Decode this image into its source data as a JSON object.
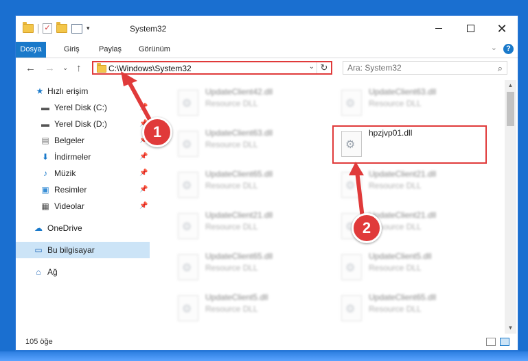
{
  "window": {
    "title": "System32",
    "controls": {
      "minimize": "minimize",
      "maximize": "maximize",
      "close": "✕"
    }
  },
  "ribbon": {
    "tabs": [
      "Dosya",
      "Giriş",
      "Paylaş",
      "Görünüm"
    ]
  },
  "address": {
    "path": "C:\\Windows\\System32",
    "search_placeholder": "Ara: System32"
  },
  "navigation": {
    "items": [
      {
        "label": "Hızlı erişim",
        "icon": "star-icon",
        "pinned": false
      },
      {
        "label": "Yerel Disk (C:)",
        "icon": "drive-icon",
        "pinned": true
      },
      {
        "label": "Yerel Disk (D:)",
        "icon": "drive-icon",
        "pinned": true
      },
      {
        "label": "Belgeler",
        "icon": "documents-icon",
        "pinned": true
      },
      {
        "label": "İndirmeler",
        "icon": "downloads-icon",
        "pinned": true
      },
      {
        "label": "Müzik",
        "icon": "music-icon",
        "pinned": true
      },
      {
        "label": "Resimler",
        "icon": "pictures-icon",
        "pinned": true
      },
      {
        "label": "Videolar",
        "icon": "videos-icon",
        "pinned": true
      },
      {
        "label": "OneDrive",
        "icon": "cloud-icon",
        "pinned": false
      },
      {
        "label": "Bu bilgisayar",
        "icon": "computer-icon",
        "pinned": false,
        "selected": true
      },
      {
        "label": "Ağ",
        "icon": "network-icon",
        "pinned": false
      }
    ]
  },
  "files": {
    "left_column": [
      {
        "name": "UpdateClient42.dll",
        "type": "Resource DLL"
      },
      {
        "name": "UpdateClient63.dll",
        "type": "Resource DLL"
      },
      {
        "name": "UpdateClient65.dll",
        "type": "Resource DLL"
      },
      {
        "name": "UpdateClient21.dll",
        "type": "Resource DLL"
      },
      {
        "name": "UpdateClient65.dll",
        "type": "Resource DLL"
      },
      {
        "name": "UpdateClient5.dll",
        "type": "Resource DLL"
      }
    ],
    "right_column": [
      {
        "name": "UpdateClient63.dll",
        "type": "Resource DLL"
      },
      {
        "name": "hpzjvp01.dll",
        "type": "",
        "highlighted": true
      },
      {
        "name": "UpdateClient21.dll",
        "type": "Resource DLL"
      },
      {
        "name": "UpdateClient21.dll",
        "type": "Resource DLL"
      },
      {
        "name": "UpdateClient5.dll",
        "type": "Resource DLL"
      },
      {
        "name": "UpdateClient65.dll",
        "type": "Resource DLL"
      }
    ]
  },
  "status": {
    "item_count": "105 öğe"
  },
  "callouts": {
    "first": "1",
    "second": "2",
    "color": "#e03a3a"
  }
}
